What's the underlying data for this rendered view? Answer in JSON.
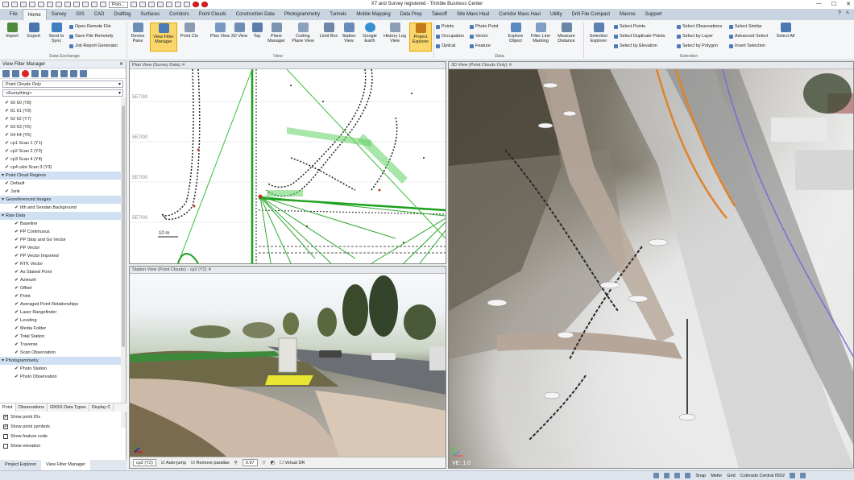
{
  "window": {
    "title": "X7 and Survey registered - Trimble Business Center",
    "quick_search": "Poin..."
  },
  "menu": {
    "tabs": [
      "File",
      "Home",
      "Survey",
      "GIS",
      "CAD",
      "Drafting",
      "Surfaces",
      "Corridors",
      "Point Clouds",
      "Construction Data",
      "Photogrammetry",
      "Tunnels",
      "Mobile Mapping",
      "Data Prep",
      "Takeoff",
      "Site Mass Haul",
      "Corridor Mass Haul",
      "Utility",
      "Drill File Compact",
      "Macros",
      "Support"
    ],
    "active_index": 1
  },
  "ribbon": {
    "data_exchange": {
      "label": "Data Exchange",
      "import": "Import",
      "export": "Export",
      "send_to_sync": "Send to Sync",
      "open_remote_file": "Open Remote File",
      "save_file_remotely": "Save File Remotely",
      "job_report_generator": "Job Report Generator"
    },
    "view": {
      "label": "View",
      "device_pane": "Device Pane",
      "view_filter_manager": "View Filter Manager",
      "point_clo": "Point Clo",
      "plan_view": "Plan View",
      "view_3d": "3D View",
      "top": "Top",
      "plane_manager": "Plane Manager",
      "cutting_plane_view": "Cutting Plane View",
      "limit_box": "Limit Box",
      "station_view": "Station View",
      "google_earth": "Google Earth",
      "history_log_view": "History Log View",
      "project_explorer": "Project Explorer"
    },
    "data": {
      "label": "Data",
      "points": "Points",
      "occupation": "Occupation",
      "optical": "Optical",
      "photo_point": "Photo Point",
      "vector": "Vector",
      "feature": "Feature",
      "explore_object": "Explore Object",
      "filter_line_marking": "Filter Line Marking",
      "measure_distance": "Measure Distance"
    },
    "selection": {
      "label": "Selection",
      "selection_explorer": "Selection Explorer",
      "select_points": "Select Points",
      "select_duplicate_points": "Select Duplicate Points",
      "select_by_elevation": "Select by Elevation",
      "select_observations": "Select Observations",
      "select_by_layer": "Select by Layer",
      "select_by_polygon": "Select by Polygon",
      "select_similar": "Select Similar",
      "advanced_select": "Advanced Select",
      "invert_selection": "Invert Selection",
      "select_all": "Select All"
    }
  },
  "left_panel": {
    "title": "View Filter Manager",
    "filter_combo": "Point Clouds Only",
    "everything_combo": "<Everything>",
    "scans": [
      "60 60 (Y8)",
      "61 61 (Y9)",
      "62 62 (Y7)",
      "63 63 (Y6)",
      "64 64 (Y5)",
      "cp1 Scan 1 (Y1)",
      "cp2 Scan 2 (Y2)",
      "cp3 Scan 4 (Y4)",
      "cp4 cdot Scan 3 (Y3)"
    ],
    "point_cloud_regions_header": "Point Cloud Regions",
    "regions": [
      "Default",
      "Junk"
    ],
    "georef_header": "Georeferenced Images",
    "georef_items": [
      "Itth and Sendan Background"
    ],
    "raw_data_header": "Raw Data",
    "raw_items": [
      "Baseline",
      "PP Continuous",
      "PP Stop and Go Vector",
      "PP Vector",
      "PP Vector Imported",
      "RTK Vector",
      "As Staked Point",
      "Azimuth",
      "Offset",
      "Point",
      "Averaged Point Relationships",
      "Laser Rangefinder",
      "Leveling",
      "Media Folder",
      "Total Station",
      "Traverse",
      "Scan Observation"
    ],
    "photogrammetry_header": "Photogrammetry",
    "photo_items": [
      "Photo Station",
      "Photo Observation"
    ],
    "bottom_tabs": [
      "Point",
      "Observations",
      "GNSS Data Types",
      "Display C"
    ],
    "options": [
      "Show point IDs",
      "Show point symbols",
      "Show feature code",
      "Show elevation"
    ],
    "panel_tabs": [
      "Project Explorer",
      "View Filter Manager"
    ]
  },
  "plan_view": {
    "tab": "Plan View (Survey Data)",
    "y_labels": [
      "5E7/30",
      "5E7/00",
      "5E7/00",
      "5E7/00"
    ],
    "scale": "10 m"
  },
  "station_view": {
    "tab": "Station View (Point Clouds) - cp2 (Y2)",
    "station_combo": "cp2 (Y2)",
    "auto_jump": "Auto-jump",
    "remove_parallax": "Remove parallax",
    "zoom": "0.97",
    "virtual_dr": "Virtual DR"
  },
  "view_3d": {
    "tab": "3D View (Point Clouds Only)",
    "ve_label": "VE: 1.0"
  },
  "status_bar": {
    "snap": "Snap",
    "units": "Meter",
    "grid": "Grid",
    "coord_system": "Colorado Central 0502"
  }
}
